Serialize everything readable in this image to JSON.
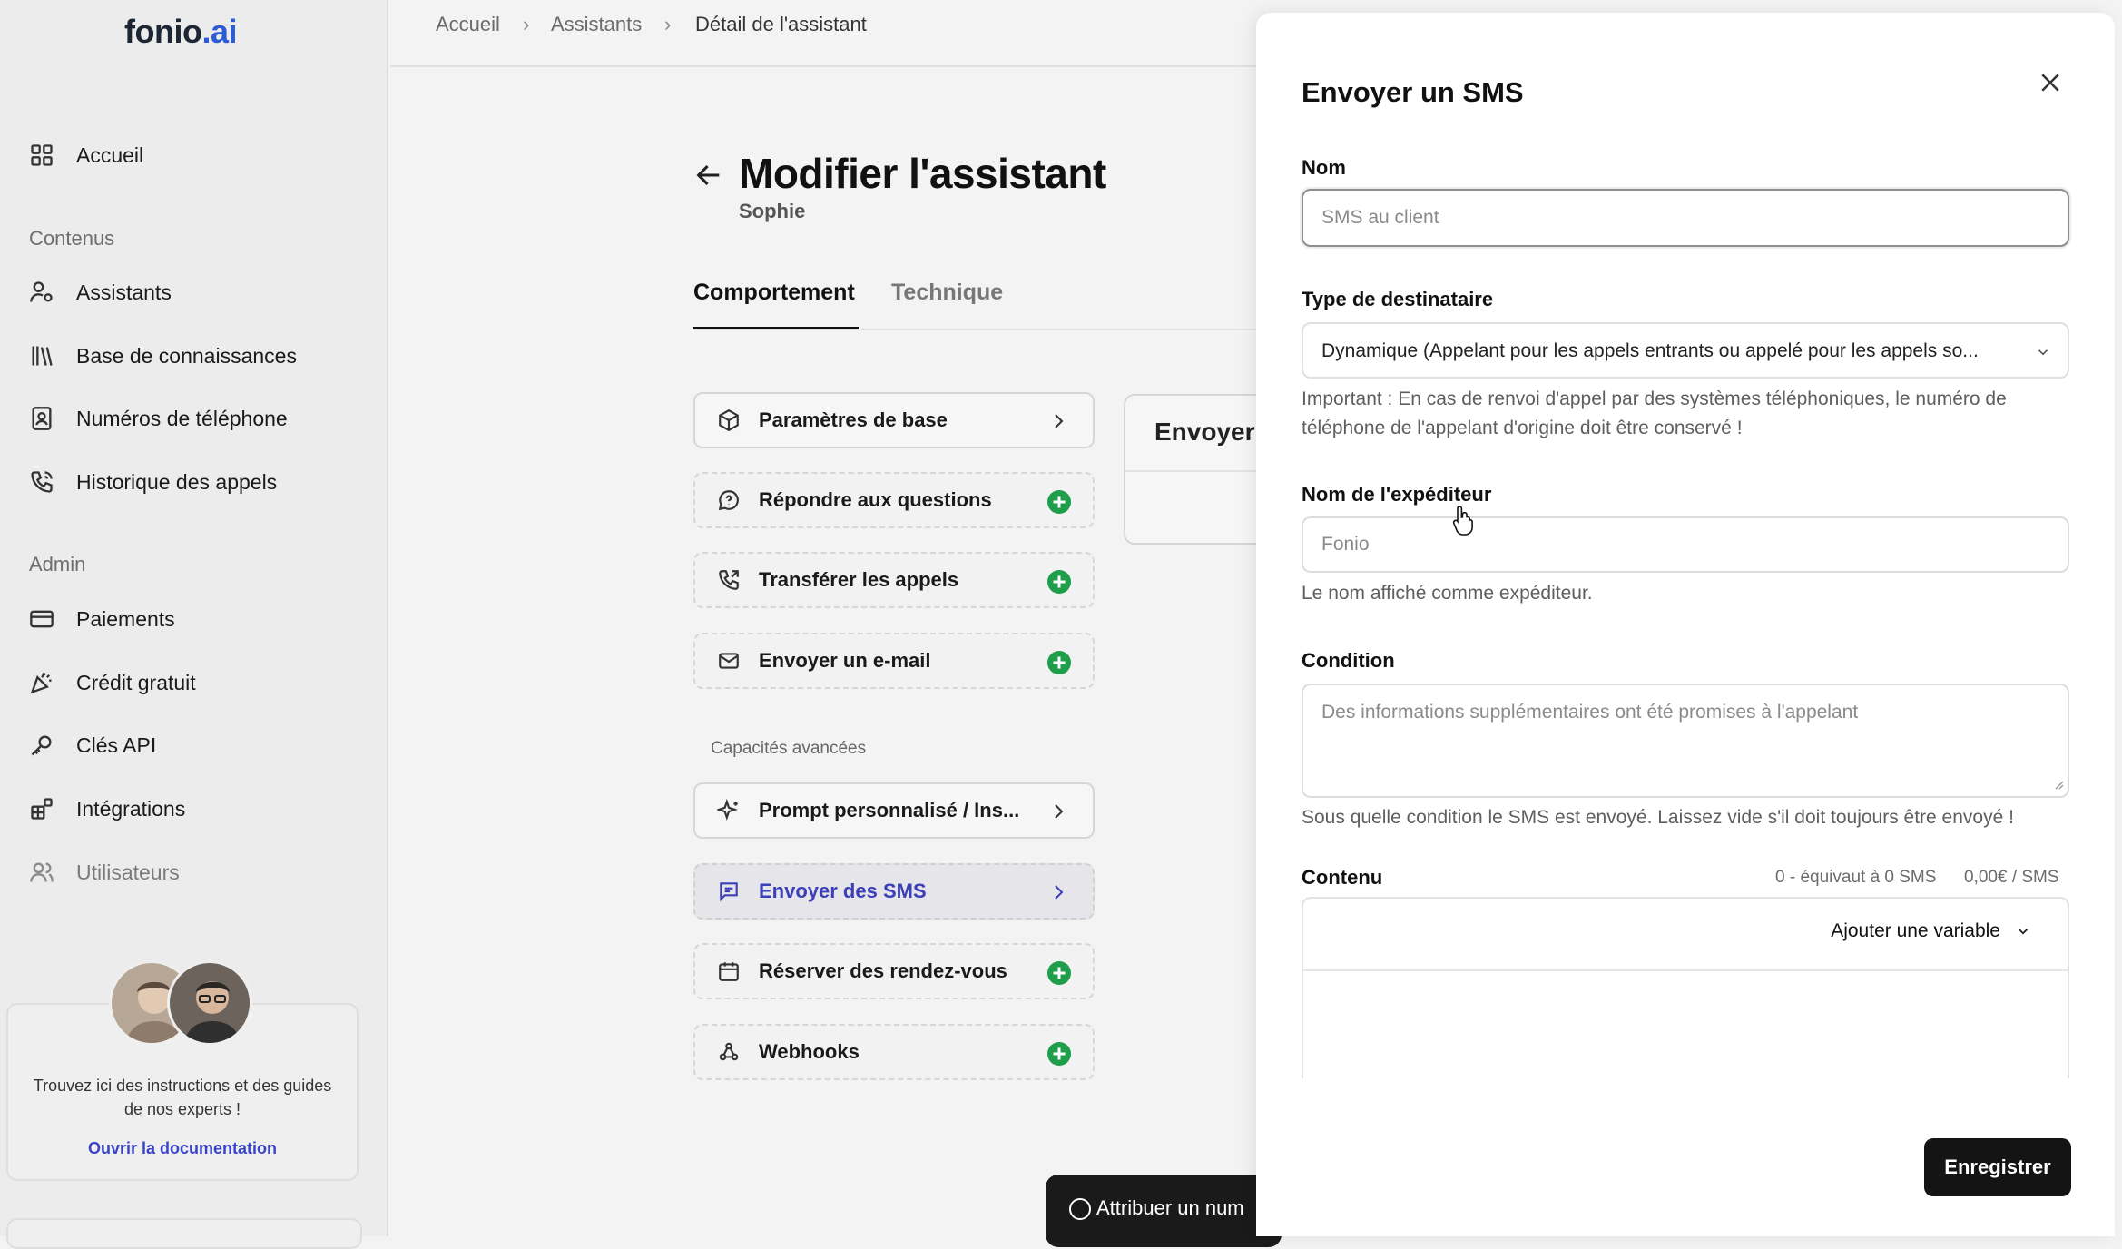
{
  "app": {
    "logo_main": "fonio",
    "logo_tld": ".ai"
  },
  "sidebar": {
    "home": "Accueil",
    "section_content": "Contenus",
    "content_items": [
      {
        "label": "Assistants",
        "icon": "user-gear-icon"
      },
      {
        "label": "Base de connaissances",
        "icon": "library-icon"
      },
      {
        "label": "Numéros de téléphone",
        "icon": "contact-card-icon"
      },
      {
        "label": "Historique des appels",
        "icon": "phone-history-icon"
      }
    ],
    "section_admin": "Admin",
    "admin_items": [
      {
        "label": "Paiements",
        "icon": "credit-card-icon"
      },
      {
        "label": "Crédit gratuit",
        "icon": "party-popper-icon"
      },
      {
        "label": "Clés API",
        "icon": "key-icon"
      },
      {
        "label": "Intégrations",
        "icon": "integrations-icon"
      },
      {
        "label": "Utilisateurs",
        "icon": "users-icon"
      }
    ],
    "help": {
      "text": "Trouvez ici des instructions et des guides de nos experts !",
      "link": "Ouvrir la documentation"
    }
  },
  "breadcrumb": {
    "items": [
      "Accueil",
      "Assistants",
      "Détail de l'assistant"
    ]
  },
  "page": {
    "title": "Modifier l'assistant",
    "subtitle": "Sophie",
    "tabs": [
      "Comportement",
      "Technique"
    ],
    "capabilities": [
      {
        "label": "Paramètres de base",
        "state": "configured"
      },
      {
        "label": "Répondre aux questions",
        "state": "add"
      },
      {
        "label": "Transférer les appels",
        "state": "add"
      },
      {
        "label": "Envoyer un e-mail",
        "state": "add"
      }
    ],
    "advanced_label": "Capacités avancées",
    "advanced": [
      {
        "label": "Prompt personnalisé / Ins...",
        "state": "configured"
      },
      {
        "label": "Envoyer des SMS",
        "state": "selected"
      },
      {
        "label": "Réserver des rendez-vous",
        "state": "add"
      },
      {
        "label": "Webhooks",
        "state": "add"
      }
    ],
    "peek_card_title": "Envoyer",
    "floating_button": "Attribuer un num"
  },
  "drawer": {
    "title": "Envoyer un SMS",
    "name_label": "Nom",
    "name_placeholder": "SMS au client",
    "recipient_label": "Type de destinataire",
    "recipient_value": "Dynamique (Appelant pour les appels entrants ou appelé pour les appels so...",
    "recipient_hint": "Important : En cas de renvoi d'appel par des systèmes téléphoniques, le numéro de téléphone de l'appelant d'origine doit être conservé !",
    "sender_label": "Nom de l'expéditeur",
    "sender_placeholder": "Fonio",
    "sender_hint": "Le nom affiché comme expéditeur.",
    "condition_label": "Condition",
    "condition_placeholder": "Des informations supplémentaires ont été promises à l'appelant",
    "condition_hint": "Sous quelle condition le SMS est envoyé. Laissez vide s'il doit toujours être envoyé !",
    "content_label": "Contenu",
    "content_count": "0 - équivaut à 0 SMS",
    "content_price": "0,00€ / SMS",
    "add_variable": "Ajouter une variable",
    "save": "Enregistrer"
  },
  "colors": {
    "accent": "#3b3fb8",
    "add_green": "#1e9d4a",
    "primary_button": "#141414"
  }
}
